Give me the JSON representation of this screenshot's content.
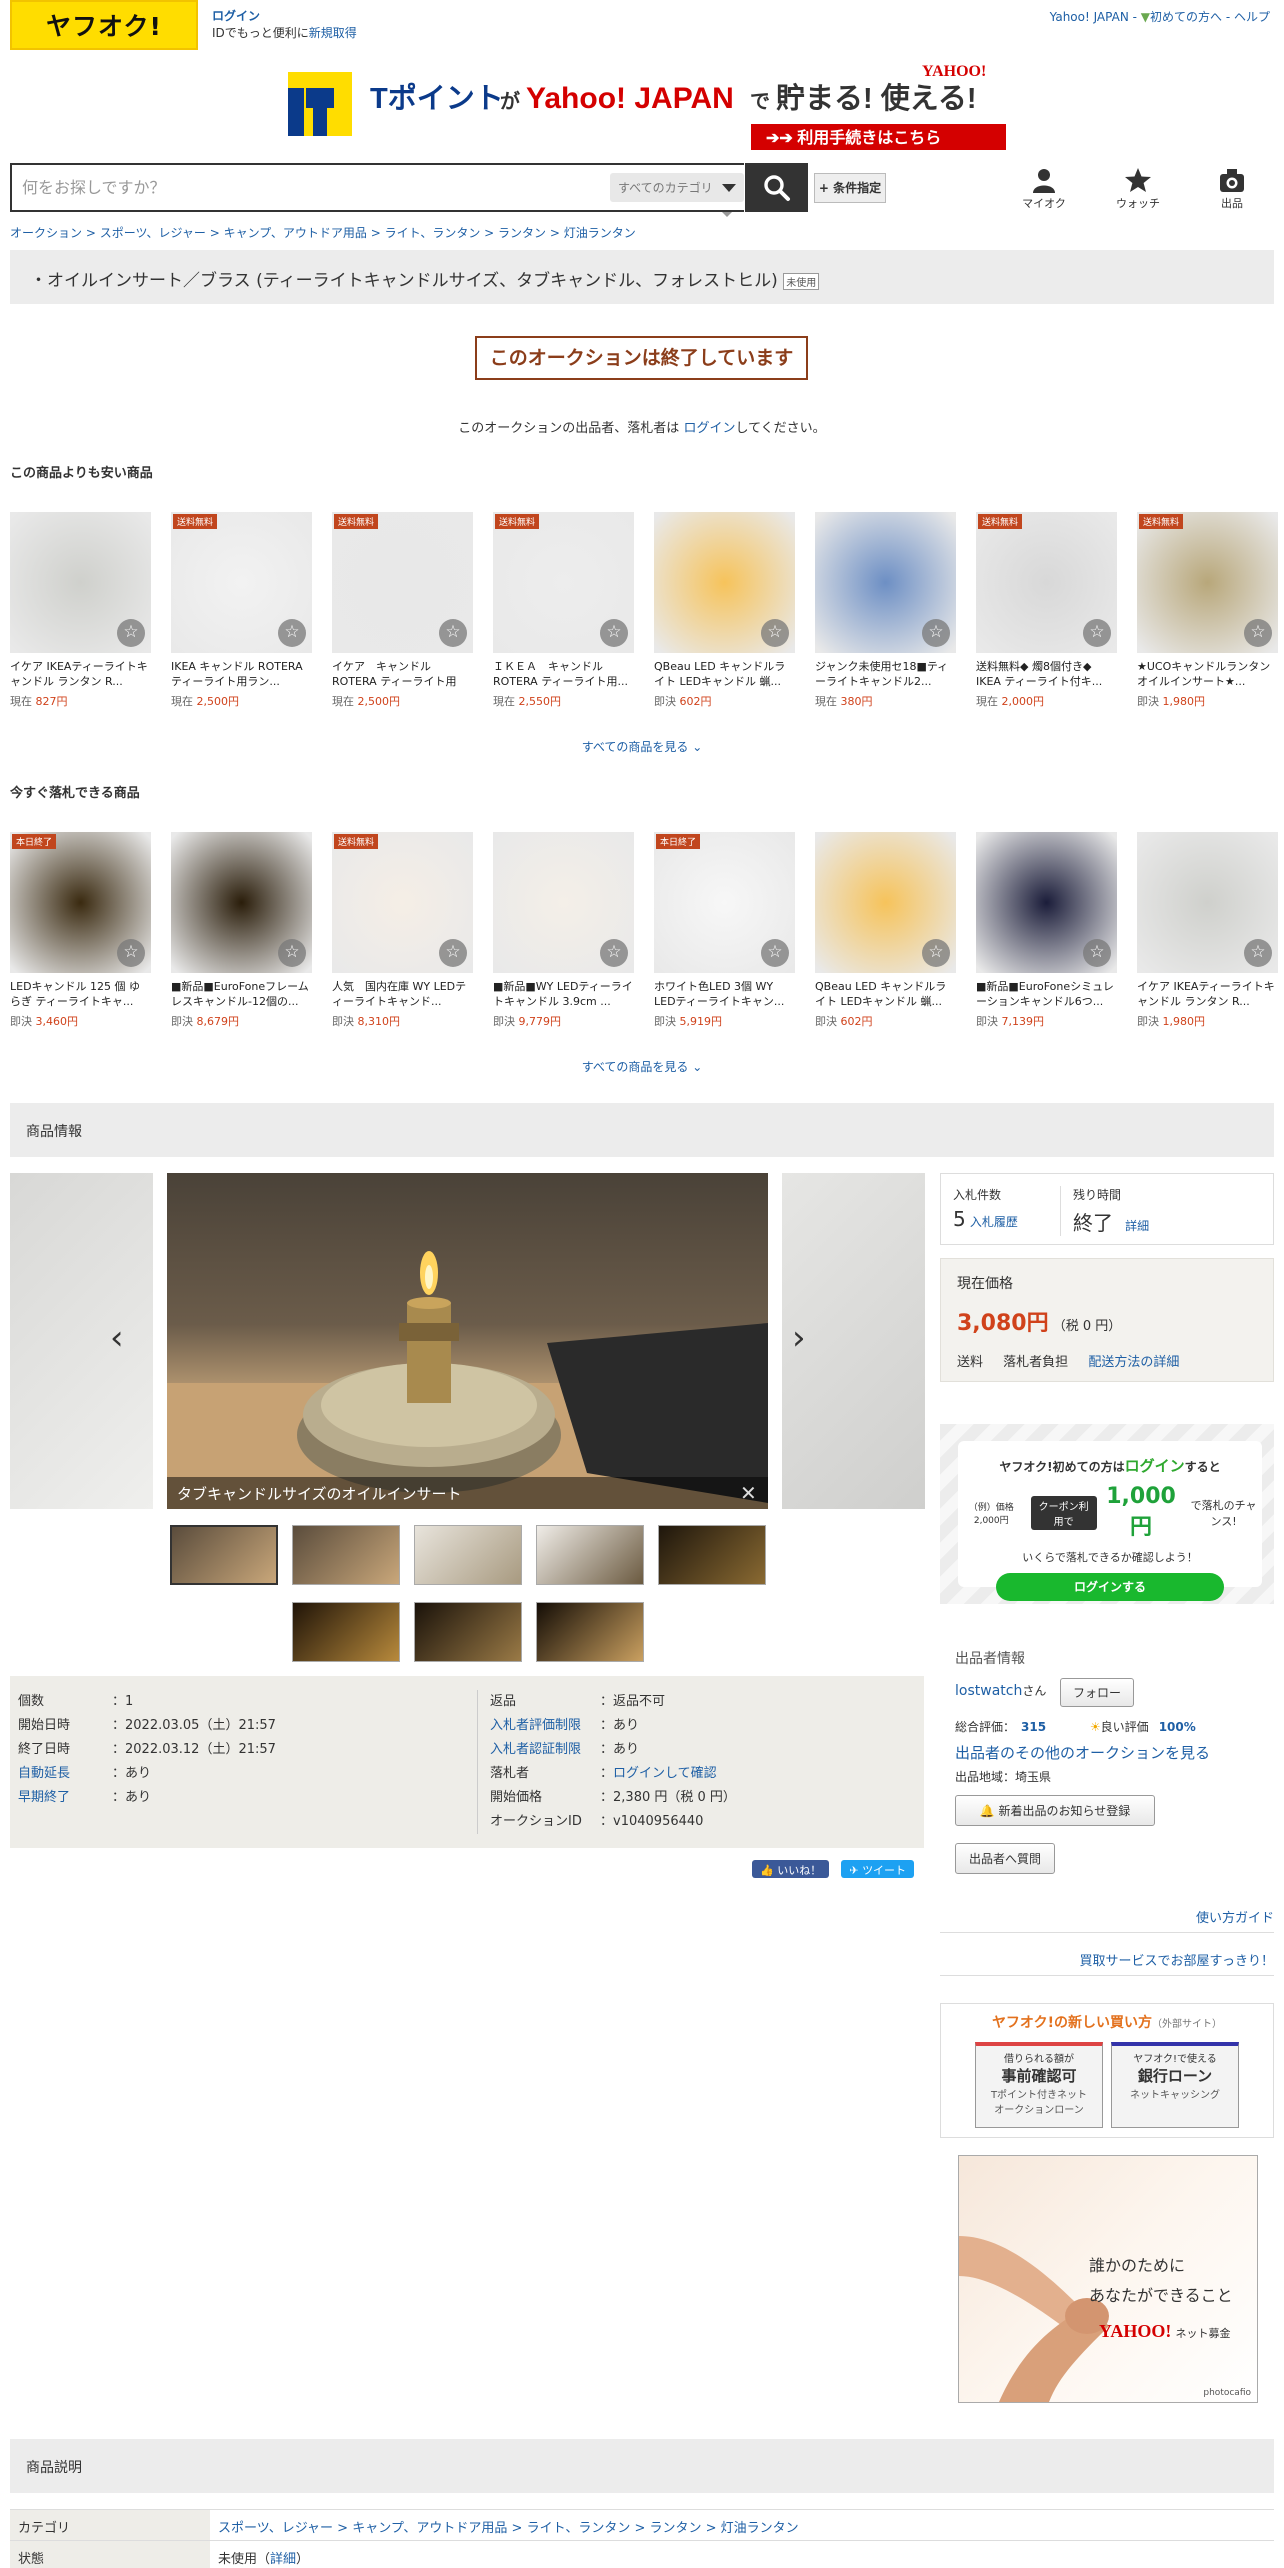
{
  "header": {
    "logo": "ヤフオク!",
    "login": "ログイン",
    "login_sub": "IDでもっと便利に",
    "signup": "新規取得",
    "top_links": [
      "Yahoo! JAPAN",
      "初めての方へ",
      "ヘルプ"
    ],
    "banner_text": "Tポイントが Yahoo! JAPANで 貯まる! 使える!",
    "banner_button": "利用手続きはこちら",
    "search_placeholder": "何をお探しですか？",
    "category_select": "すべてのカテゴリ",
    "conditions": "+ 条件指定",
    "icons": [
      {
        "label": "マイオク",
        "icon": "person-icon"
      },
      {
        "label": "ウォッチ",
        "icon": "star-icon"
      },
      {
        "label": "出品",
        "icon": "camera-icon"
      }
    ]
  },
  "breadcrumb": [
    "オークション",
    "スポーツ、レジャー",
    "キャンプ、アウトドア用品",
    "ライト、ランタン",
    "ランタン",
    "灯油ランタン"
  ],
  "title": "・オイルインサート／ブラス (ティーライトキャンドルサイズ、タブキャンドル、フォレストヒル)",
  "title_badge": "未使用",
  "ended_notice": "このオークションは終了しています",
  "login_notice_pre": "このオークションの出品者、落札者は ",
  "login_notice_link": "ログイン",
  "login_notice_post": "してください。",
  "cheaper": {
    "heading": "この商品よりも安い商品",
    "see_all": "すべての商品を見る",
    "items": [
      {
        "name": "イケア IKEAティーライトキャンドル ランタン R...",
        "kind": "現在",
        "price": "827円",
        "badge": "",
        "color": "#cfd0cc"
      },
      {
        "name": "IKEA キャンドル ROTERA ティーライト用ラン...",
        "kind": "現在",
        "price": "2,500円",
        "badge": "送料無料",
        "color": "#f2f2f2"
      },
      {
        "name": "イケア　キャンドル ROTERA ティーライト用ラ...",
        "kind": "現在",
        "price": "2,500円",
        "badge": "送料無料",
        "color": "#e8e8e8"
      },
      {
        "name": "ＩＫＥＡ　キャンドル ROTERA ティーライト用...",
        "kind": "現在",
        "price": "2,550円",
        "badge": "送料無料",
        "color": "#ededed"
      },
      {
        "name": "QBeau LED キャンドルライト LEDキャンドル 蝋...",
        "kind": "即決",
        "price": "602円",
        "badge": "",
        "color": "#f6c35b"
      },
      {
        "name": "ジャンク未使用セ18■ティーライトキャンドル2...",
        "kind": "現在",
        "price": "380円",
        "badge": "",
        "color": "#6d8fc4"
      },
      {
        "name": "送料無料◆ 燭8個付き◆ IKEA ティーライト付キ...",
        "kind": "現在",
        "price": "2,000円",
        "badge": "送料無料",
        "color": "#d8d8d8"
      },
      {
        "name": "★UCOキャンドルランタン オイルインサート★...",
        "kind": "即決",
        "price": "1,980円",
        "badge": "送料無料",
        "color": "#b8a77a"
      }
    ]
  },
  "buynow": {
    "heading": "今すぐ落札できる商品",
    "see_all": "すべての商品を見る",
    "items": [
      {
        "name": "LEDキャンドル 125 個 ゆらぎ ティーライトキャ...",
        "kind": "即決",
        "price": "3,460円",
        "badge": "本日終了",
        "color": "#3a2a10"
      },
      {
        "name": "■新品■EuroFoneフレームレスキャンドル-12個の...",
        "kind": "即決",
        "price": "8,679円",
        "badge": "",
        "color": "#2a1d0a"
      },
      {
        "name": "人気　国内在庫 WY LEDティーライトキャンド...",
        "kind": "即決",
        "price": "8,310円",
        "badge": "送料無料",
        "color": "#f5eee6"
      },
      {
        "name": "■新品■WY LEDティーライトキャンドル 3.9cm ...",
        "kind": "即決",
        "price": "9,779円",
        "badge": "",
        "color": "#f4efe8"
      },
      {
        "name": "ホワイト色LED 3個 WY LEDティーライトキャン...",
        "kind": "即決",
        "price": "5,919円",
        "badge": "本日終了",
        "color": "#f7f7f7"
      },
      {
        "name": "QBeau LED キャンドルライト LEDキャンドル 蝋...",
        "kind": "即決",
        "price": "602円",
        "badge": "",
        "color": "#f6c35b"
      },
      {
        "name": "■新品■EuroFoneシミュレーションキャンドル6つ...",
        "kind": "即決",
        "price": "7,139円",
        "badge": "",
        "color": "#1b1d3a"
      },
      {
        "name": "イケア IKEAティーライトキャンドル ランタン R...",
        "kind": "即決",
        "price": "1,980円",
        "badge": "",
        "color": "#cfd0cc"
      }
    ]
  },
  "product_info_heading": "商品情報",
  "gallery_caption": "タブキャンドルサイズのオイルインサート",
  "details": {
    "left": [
      {
        "k": "個数",
        "v": "1",
        "link": false
      },
      {
        "k": "開始日時",
        "v": "2022.03.05（土）21:57",
        "link": false
      },
      {
        "k": "終了日時",
        "v": "2022.03.12（土）21:57",
        "link": false
      },
      {
        "k": "自動延長",
        "v": "あり",
        "link": true
      },
      {
        "k": "早期終了",
        "v": "あり",
        "link": true
      }
    ],
    "right": [
      {
        "k": "返品",
        "v": "返品不可",
        "link": false
      },
      {
        "k": "入札者評価制限",
        "v": "あり",
        "link": true
      },
      {
        "k": "入札者認証制限",
        "v": "あり",
        "link": true
      },
      {
        "k": "落札者",
        "v": "ログインして確認",
        "link": false
      },
      {
        "k": "開始価格",
        "v": "2,380 円（税 0 円）",
        "link": false
      },
      {
        "k": "オークションID",
        "v": "v1040956440",
        "link": false
      }
    ]
  },
  "social": {
    "like": "いいね！",
    "tweet": "ツイート"
  },
  "bid": {
    "count_label": "入札件数",
    "count": "5",
    "history": "入札履歴",
    "time_label": "残り時間",
    "time": "終了",
    "detail": "詳細"
  },
  "price": {
    "label": "現在価格",
    "value": "3,080円",
    "tax": "（税 0 円）",
    "shipping_label": "送料",
    "shipping": "落札者負担",
    "shipping_link": "配送方法の詳細"
  },
  "promo": {
    "line1_pre": "ヤフオク!初めての方は",
    "line1_link": "ログイン",
    "line1_post": "すると",
    "example": "（例）価格2,000円",
    "coupon": "クーポン利用で",
    "amount": "1,000円",
    "tail": "で落札のチャンス!",
    "line3": "いくらで落札できるか確認しよう！",
    "button": "ログインする"
  },
  "seller": {
    "heading": "出品者情報",
    "name": "lostwatch",
    "suffix": "さん",
    "follow": "フォロー",
    "rating_label": "総合評価：",
    "rating": "315",
    "good_label": "良い評価",
    "good": "100%",
    "other": "出品者のその他のオークションを見る",
    "region": "出品地域：埼玉県",
    "notify": "新着出品のお知らせ登録",
    "question": "出品者へ質問"
  },
  "guide": "使い方ガイド",
  "service": "買取サービスでお部屋すっきり！",
  "new_buy": {
    "title": "ヤフオク!の新しい買い方",
    "ext": "（外部サイト）",
    "card1_top": "借りられる額が",
    "card1_main": "事前確認可",
    "card1_sub": "Tポイント付きネット\nオークションローン",
    "card2_top": "ヤフオク!で使える",
    "card2_main": "銀行ローン",
    "card2_sub": "ネットキャッシング"
  },
  "ad": {
    "line1": "誰かのために",
    "line2": "あなたができること",
    "brand": "YAHOO!",
    "brand_sub": "ネット募金",
    "credit": "photocafio"
  },
  "description_heading": "商品説明",
  "desc_table": {
    "category_label": "カテゴリ",
    "category": "スポーツ、レジャー > キャンプ、アウトドア用品 > ライト、ランタン > ランタン > 灯油ランタン",
    "state_label": "状態",
    "state": "未使用",
    "state_link": "詳細"
  }
}
